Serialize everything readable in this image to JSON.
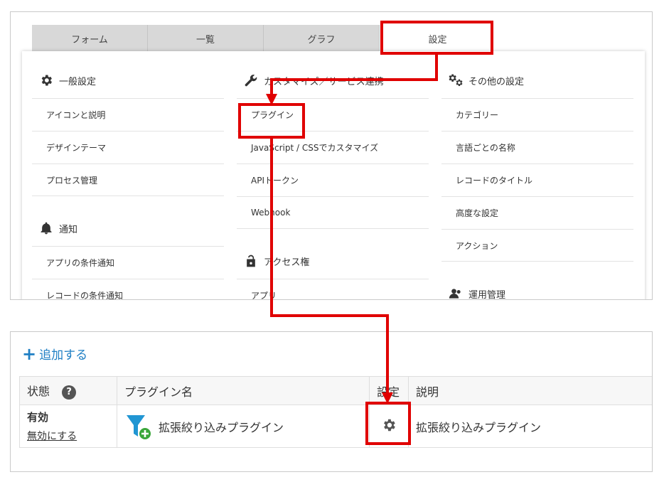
{
  "tabs": [
    "フォーム",
    "一覧",
    "グラフ",
    "設定"
  ],
  "settings": {
    "general": {
      "heading": "一般設定",
      "items": [
        "アイコンと説明",
        "デザインテーマ",
        "プロセス管理"
      ]
    },
    "notification": {
      "heading": "通知",
      "items": [
        "アプリの条件通知",
        "レコードの条件通知"
      ]
    },
    "customize": {
      "heading": "カスタマイズ／サービス連携",
      "items": [
        "プラグイン",
        "JavaScript / CSSでカスタマイズ",
        "APIトークン",
        "Webhook"
      ]
    },
    "access": {
      "heading": "アクセス権",
      "items": [
        "アプリ"
      ]
    },
    "other": {
      "heading": "その他の設定",
      "items": [
        "カテゴリー",
        "言語ごとの名称",
        "レコードのタイトル",
        "高度な設定",
        "アクション"
      ]
    },
    "operation": {
      "heading": "運用管理"
    }
  },
  "plugins": {
    "add_label": "追加する",
    "columns": {
      "status": "状態",
      "name": "プラグイン名",
      "settings": "設定",
      "description": "説明"
    },
    "rows": [
      {
        "status": "有効",
        "toggle": "無効にする",
        "name": "拡張絞り込みプラグイン",
        "description": "拡張絞り込みプラグイン"
      }
    ]
  },
  "colors": {
    "highlight": "#e00000",
    "link": "#1f7fc4",
    "tab_inactive": "#d8d8d8",
    "plugin_icon_primary": "#2196d3",
    "plugin_icon_badge": "#3aa63a"
  }
}
